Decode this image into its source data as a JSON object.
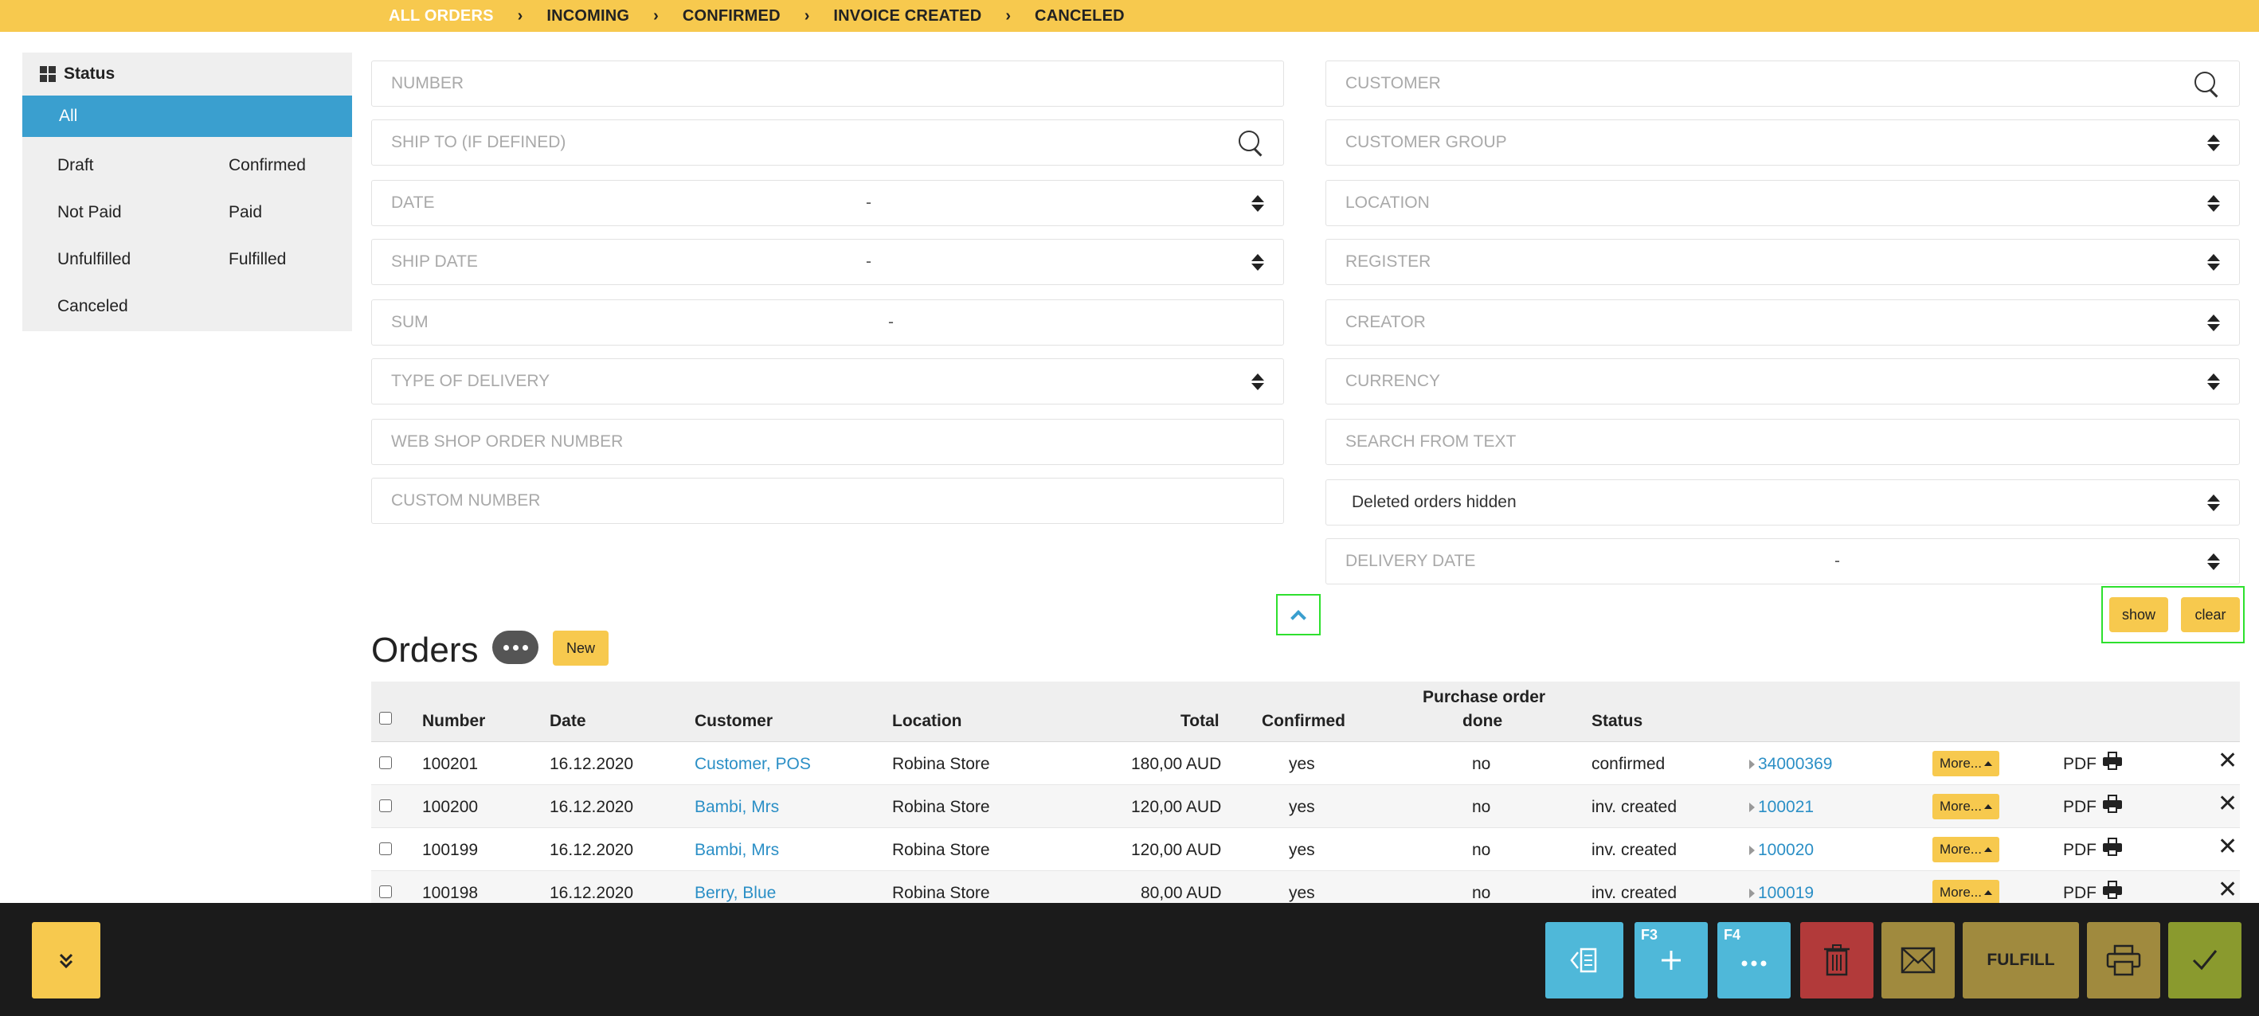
{
  "breadcrumb": [
    "ALL ORDERS",
    "INCOMING",
    "CONFIRMED",
    "INVOICE CREATED",
    "CANCELED"
  ],
  "sidebar": {
    "title": "Status",
    "all_label": "All",
    "left_items": [
      "Draft",
      "Not Paid",
      "Unfulfilled",
      "Canceled"
    ],
    "right_items": [
      "Confirmed",
      "Paid",
      "Fulfilled"
    ]
  },
  "filters": {
    "number": "NUMBER",
    "ship_to": "SHIP TO (IF DEFINED)",
    "date": "DATE",
    "ship_date": "SHIP DATE",
    "sum": "SUM",
    "type_of_delivery": "TYPE OF DELIVERY",
    "web_shop_order_number": "WEB SHOP ORDER NUMBER",
    "custom_number": "CUSTOM NUMBER",
    "customer": "CUSTOMER",
    "customer_group": "CUSTOMER GROUP",
    "location": "LOCATION",
    "register": "REGISTER",
    "creator": "CREATOR",
    "currency": "CURRENCY",
    "search_from_text": "SEARCH FROM TEXT",
    "deleted_orders": "Deleted orders hidden",
    "delivery_date": "DELIVERY DATE",
    "range_dash": "-"
  },
  "buttons": {
    "show": "show",
    "clear": "clear",
    "new": "New",
    "more": "More...",
    "pdf": "PDF",
    "close": "✕",
    "fulfill": "FULFILL",
    "f3": "F3",
    "f4": "F4"
  },
  "orders": {
    "title": "Orders",
    "columns": {
      "number": "Number",
      "date": "Date",
      "customer": "Customer",
      "location": "Location",
      "total": "Total",
      "confirmed": "Confirmed",
      "po_line1": "Purchase order",
      "po_line2": "done",
      "status": "Status"
    },
    "rows": [
      {
        "number": "100201",
        "date": "16.12.2020",
        "customer": "Customer, POS",
        "location": "Robina Store",
        "total": "180,00 AUD",
        "confirmed": "yes",
        "po_done": "no",
        "status": "confirmed",
        "ref": "34000369"
      },
      {
        "number": "100200",
        "date": "16.12.2020",
        "customer": "Bambi, Mrs",
        "location": "Robina Store",
        "total": "120,00 AUD",
        "confirmed": "yes",
        "po_done": "no",
        "status": "inv. created",
        "ref": "100021"
      },
      {
        "number": "100199",
        "date": "16.12.2020",
        "customer": "Bambi, Mrs",
        "location": "Robina Store",
        "total": "120,00 AUD",
        "confirmed": "yes",
        "po_done": "no",
        "status": "inv. created",
        "ref": "100020"
      },
      {
        "number": "100198",
        "date": "16.12.2020",
        "customer": "Berry, Blue",
        "location": "Robina Store",
        "total": "80,00 AUD",
        "confirmed": "yes",
        "po_done": "no",
        "status": "inv. created",
        "ref": "100019"
      }
    ]
  },
  "colors": {
    "accent_yellow": "#f7c94e",
    "link_blue": "#2b8fc6",
    "selected_blue": "#3a9fcf",
    "toolbar_bg": "#1b1b1b",
    "tb_blue": "#4fb8d9",
    "tb_red": "#b23a3a",
    "tb_olive": "#a08a3e",
    "tb_green": "#8a9a2e"
  }
}
